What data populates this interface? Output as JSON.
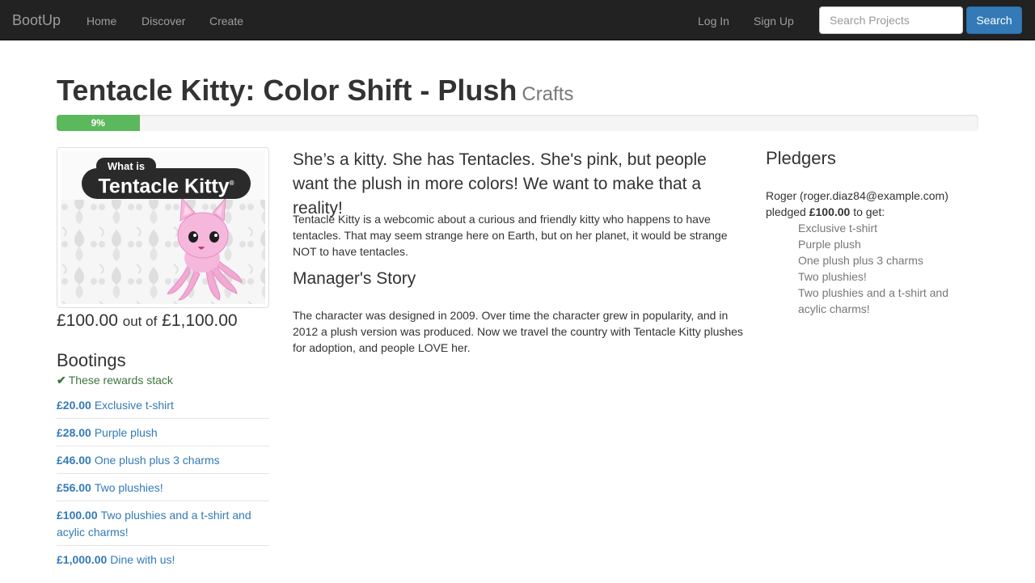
{
  "navbar": {
    "brand": "BootUp",
    "links": [
      "Home",
      "Discover",
      "Create"
    ],
    "login": "Log In",
    "signup": "Sign Up",
    "search_placeholder": "Search Projects",
    "search_button": "Search",
    "colors": {
      "background": "#222222",
      "link": "#9d9d9d",
      "button": "#337ab7"
    }
  },
  "project": {
    "title": "Tentacle Kitty: Color Shift - Plush",
    "category": "Crafts",
    "progress_label": "9%",
    "progress_fraction": 0.09,
    "image": {
      "logo_small": "What is",
      "logo_large": "Tentacle Kitty",
      "logo_mark": "®"
    },
    "funding": {
      "raised": "£100.00",
      "out_of": "out of",
      "goal": "£1,100.00"
    },
    "lead": "She’s a kitty. She has Tentacles. She's pink, but people want the plush in more colors! We want to make that a reality!",
    "description": "Tentacle Kitty is a webcomic about a curious and friendly kitty who happens to have tentacles. That may seem strange here on Earth, but on her planet, it would be strange NOT to have tentacles.",
    "story_heading": "Manager's Story",
    "story": "The character was designed in 2009. Over time the character grew in popularity, and in 2012 a plush version was produced. Now we travel the country with Tentacle Kitty plushes for adoption, and people LOVE her."
  },
  "bootings": {
    "heading": "Bootings",
    "stack_icon": "check-icon",
    "stack_note": "These rewards stack",
    "rewards": [
      {
        "price": "£20.00",
        "label": "Exclusive t-shirt"
      },
      {
        "price": "£28.00",
        "label": "Purple plush"
      },
      {
        "price": "£46.00",
        "label": "One plush plus 3 charms"
      },
      {
        "price": "£56.00",
        "label": "Two plushies!"
      },
      {
        "price": "£100.00",
        "label": "Two plushies and a t-shirt and acylic charms!"
      },
      {
        "price": "£1,000.00",
        "label": "Dine with us!"
      }
    ]
  },
  "pledgers": {
    "heading": "Pledgers",
    "entries": [
      {
        "name_email": "Roger (roger.diaz84@example.com)",
        "pledged_prefix": "pledged",
        "amount": "£100.00",
        "pledged_suffix": "to get:",
        "rewards": [
          "Exclusive t-shirt",
          "Purple plush",
          "One plush plus 3 charms",
          "Two plushies!",
          "Two plushies and a t-shirt and acylic charms!"
        ]
      }
    ]
  }
}
